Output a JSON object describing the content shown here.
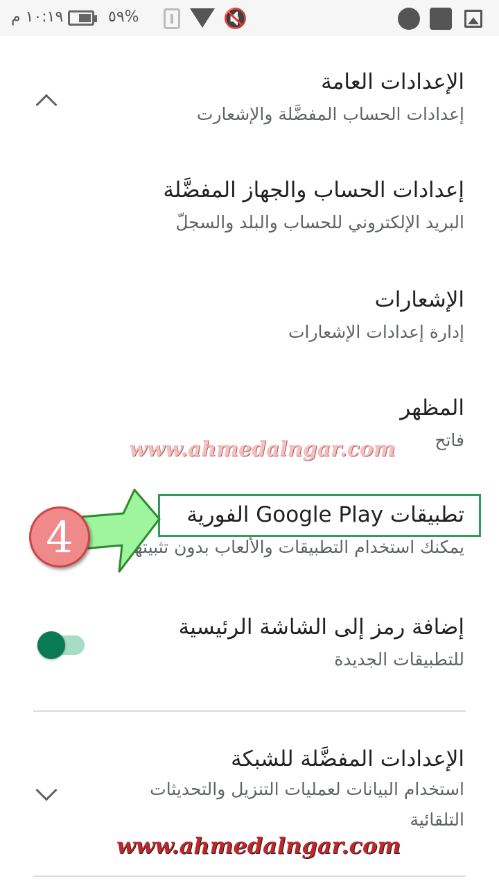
{
  "status_bar": {
    "time": "١٠:١٩ م",
    "battery_percent": "٥٩%",
    "battery_level": 0.59
  },
  "settings": {
    "general": {
      "title": "الإعدادات العامة",
      "subtitle": "إعدادات الحساب المفضَّلة والإشعارت"
    },
    "account_device": {
      "title": "إعدادات الحساب والجهاز المفضَّلة",
      "subtitle": "البريد الإلكتروني للحساب والبلد والسجلّ"
    },
    "notifications": {
      "title": "الإشعارات",
      "subtitle": "إدارة إعدادات الإشعارات"
    },
    "appearance": {
      "title": "المظهر",
      "subtitle": "فاتح"
    },
    "instant_apps": {
      "title": "تطبيقات Google Play الفورية",
      "subtitle": "يمكنك استخدام التطبيقات والألعاب بدون تثبيتها."
    },
    "home_icon": {
      "title": "إضافة رمز إلى الشاشة الرئيسية",
      "subtitle": "للتطبيقات الجديدة",
      "enabled": true
    },
    "network": {
      "title": "الإعدادات المفضَّلة للشبكة",
      "subtitle": "استخدام البيانات لعمليات التنزيل والتحديثات التلقائية"
    }
  },
  "annotation": {
    "step_number": "4",
    "watermark_1": "www.ahmedalngar.com",
    "watermark_2": "www.ahmedalngar.com"
  },
  "colors": {
    "toggle_on": "#0a7a55",
    "highlight": "#2e9d57",
    "marker": "#f08a8a"
  }
}
